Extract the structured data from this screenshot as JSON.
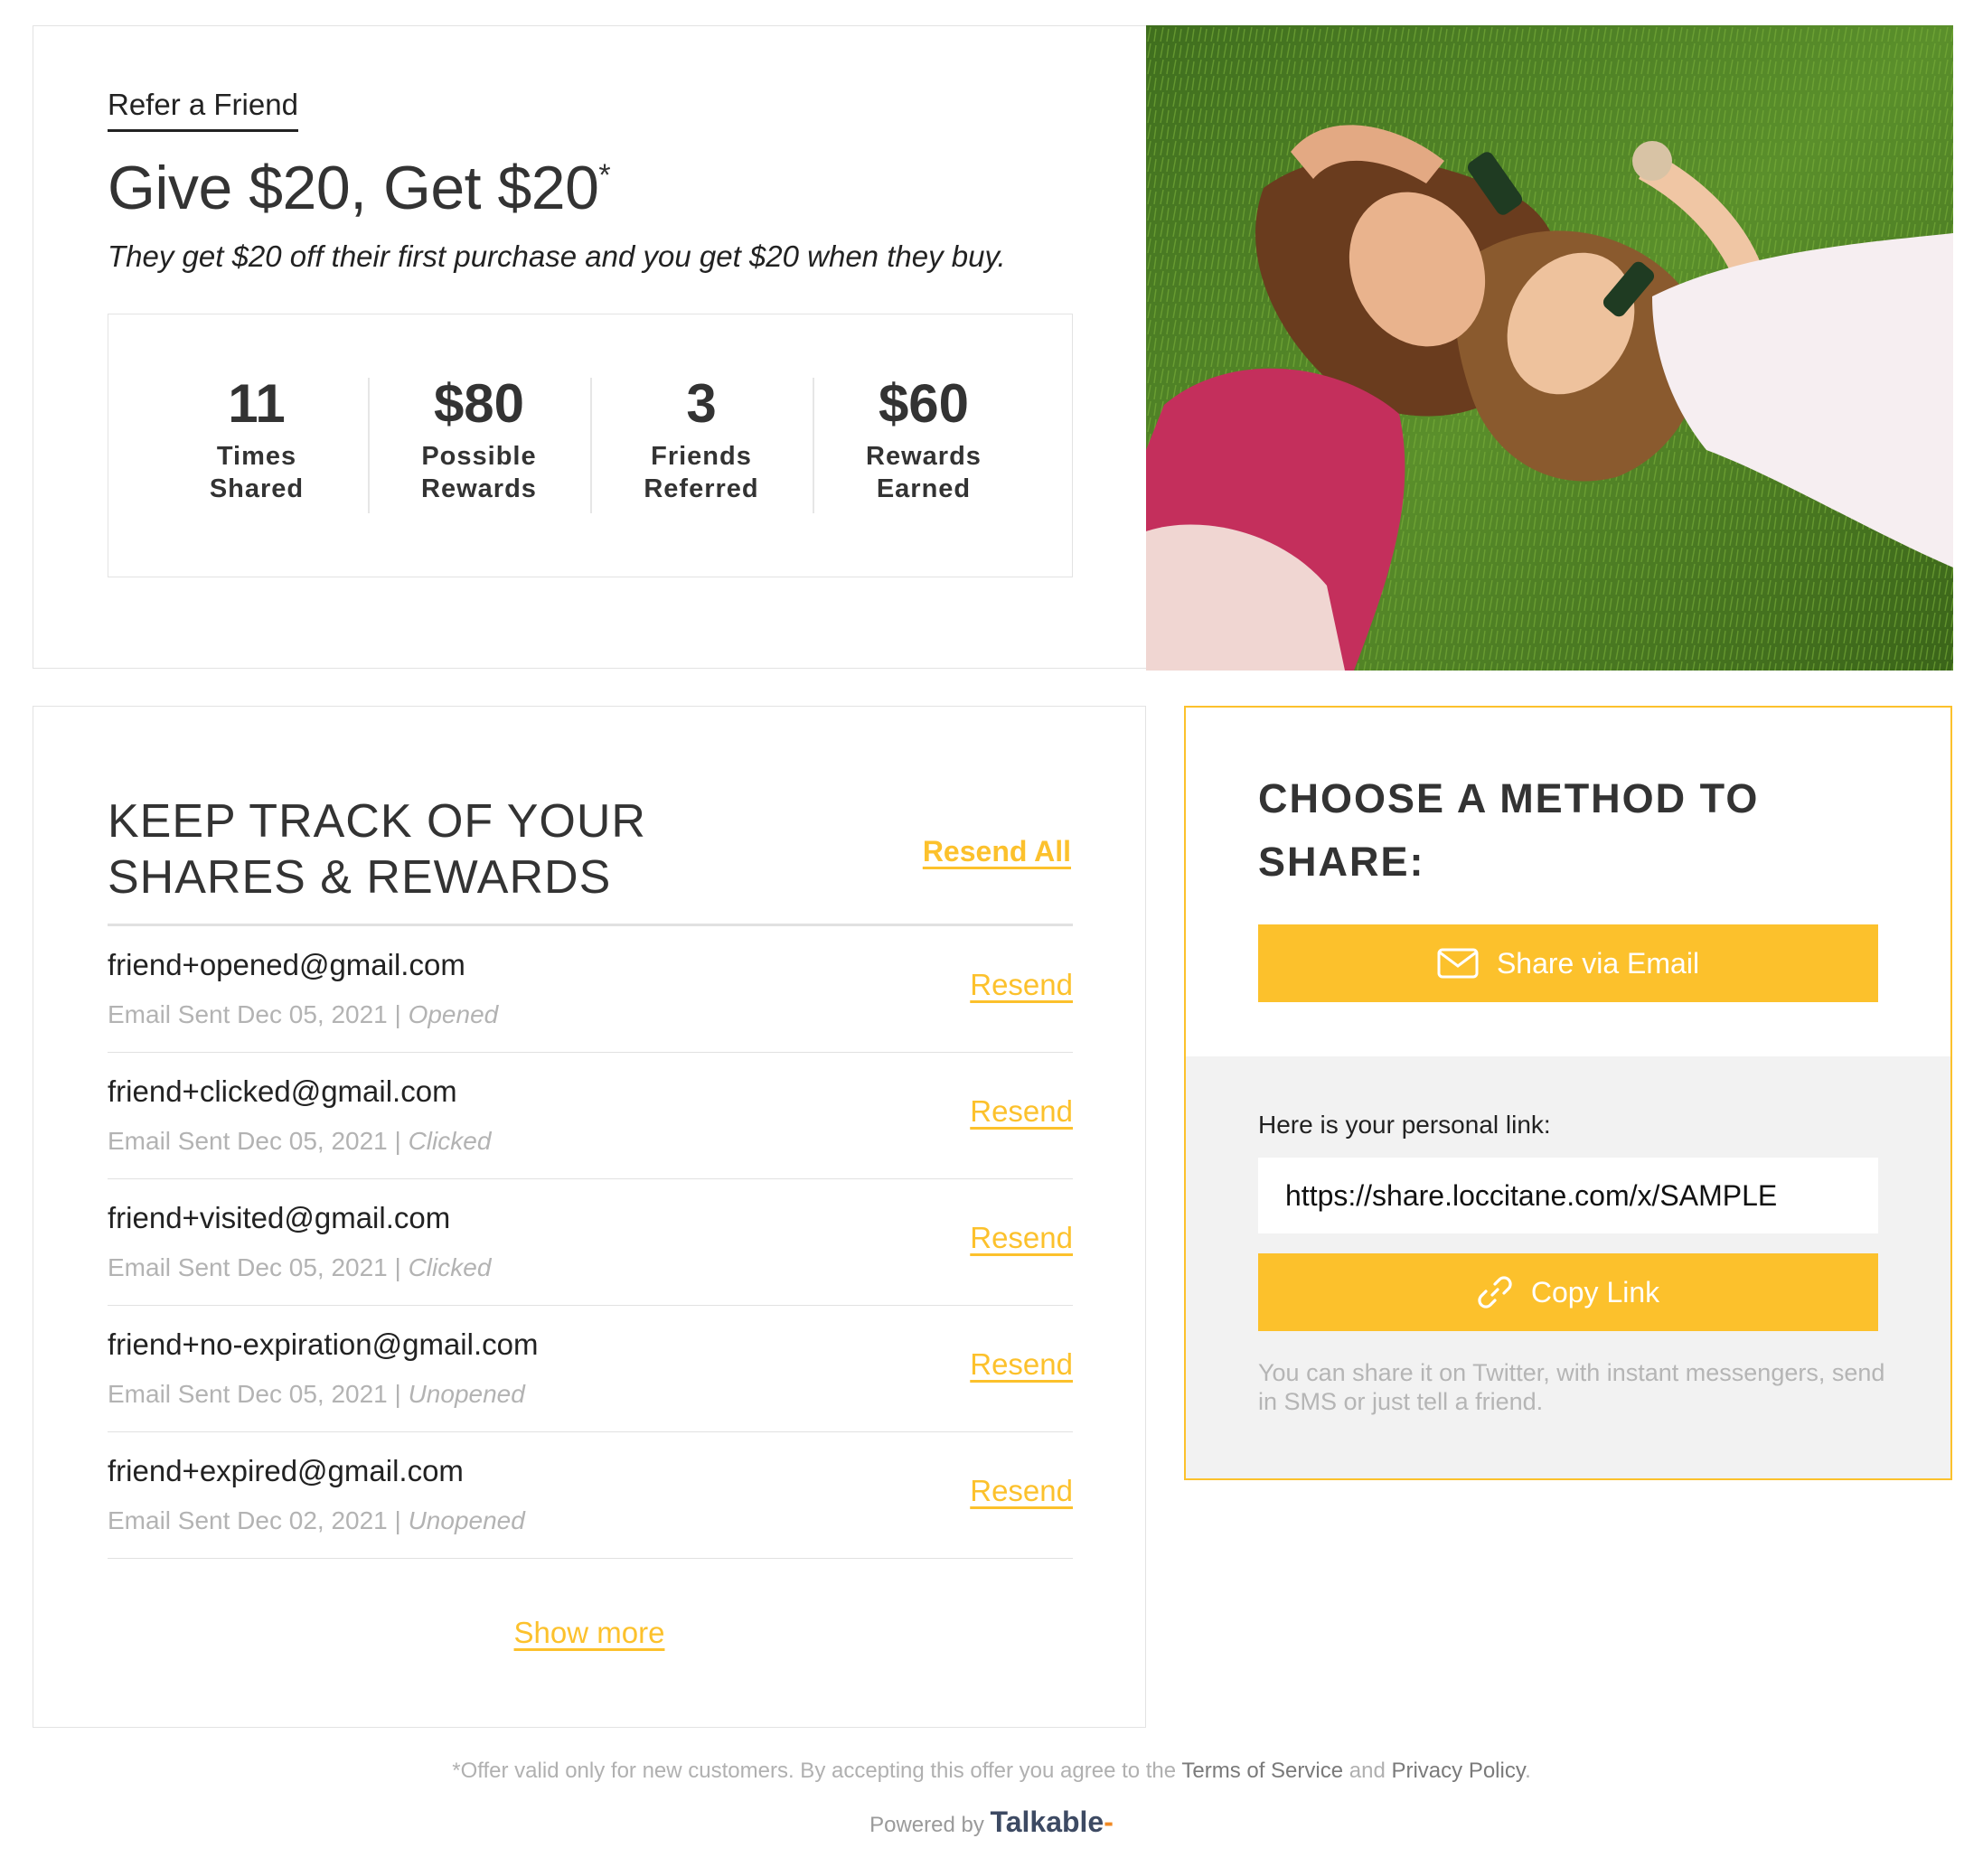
{
  "hero": {
    "refer_label": "Refer a Friend",
    "title": "Give $20, Get $20",
    "title_mark": "*",
    "subtitle": "They get $20 off their first purchase and you get $20 when they buy.",
    "stats": [
      {
        "value": "11",
        "label_line1": "Times",
        "label_line2": "Shared"
      },
      {
        "value": "$80",
        "label_line1": "Possible",
        "label_line2": "Rewards"
      },
      {
        "value": "3",
        "label_line1": "Friends",
        "label_line2": "Referred"
      },
      {
        "value": "$60",
        "label_line1": "Rewards",
        "label_line2": "Earned"
      }
    ]
  },
  "tracker": {
    "title_line1": "KEEP TRACK OF YOUR",
    "title_line2": "SHARES & REWARDS",
    "resend_all": "Resend All",
    "resend_label": "Resend",
    "show_more": "Show more",
    "shares": [
      {
        "email": "friend+opened@gmail.com",
        "sent": "Email Sent Dec 05, 2021 |",
        "status": "Opened"
      },
      {
        "email": "friend+clicked@gmail.com",
        "sent": "Email Sent Dec 05, 2021 |",
        "status": "Clicked"
      },
      {
        "email": "friend+visited@gmail.com",
        "sent": "Email Sent Dec 05, 2021 |",
        "status": "Clicked"
      },
      {
        "email": "friend+no-expiration@gmail.com",
        "sent": "Email Sent Dec 05, 2021 |",
        "status": "Unopened"
      },
      {
        "email": "friend+expired@gmail.com",
        "sent": "Email Sent Dec 02, 2021 |",
        "status": "Unopened"
      }
    ]
  },
  "share": {
    "title": "CHOOSE A METHOD TO SHARE:",
    "email_button": "Share via Email",
    "email_icon": "envelope-icon",
    "link_label": "Here is your personal link:",
    "link_value": "https://share.loccitane.com/x/SAMPLE",
    "copy_button": "Copy Link",
    "copy_icon": "link-icon",
    "hint": "You can share it on Twitter, with instant messengers, send in SMS or just tell a friend."
  },
  "footer": {
    "note_prefix": "*Offer valid only for new customers. By accepting this offer you agree to the",
    "terms": "Terms of Service",
    "and": "and",
    "privacy": "Privacy Policy",
    "period": ".",
    "powered_by": "Powered by",
    "brand": "Talkable"
  },
  "colors": {
    "accent": "#fcc12c",
    "text": "#333333",
    "muted": "#b3b3b3",
    "border": "#e3e3e3",
    "panel_gray": "#f2f2f2"
  }
}
